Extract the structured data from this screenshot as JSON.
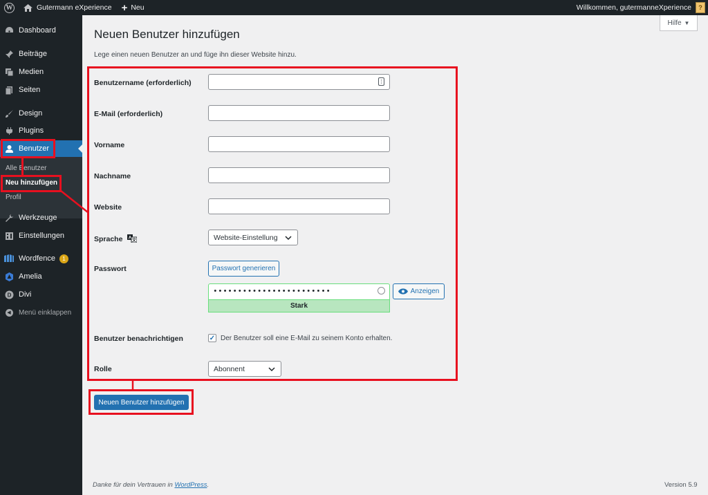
{
  "admin_bar": {
    "site_name": "Gutermann eXperience",
    "new_label": "Neu",
    "welcome": "Willkommen, gutermanneXperience"
  },
  "sidebar": {
    "items": [
      {
        "label": "Dashboard",
        "icon": "dashboard-icon"
      },
      {
        "label": "Beiträge",
        "icon": "pin-icon"
      },
      {
        "label": "Medien",
        "icon": "media-icon"
      },
      {
        "label": "Seiten",
        "icon": "pages-icon"
      },
      {
        "label": "Design",
        "icon": "brush-icon"
      },
      {
        "label": "Plugins",
        "icon": "plugin-icon"
      },
      {
        "label": "Benutzer",
        "icon": "user-icon"
      },
      {
        "label": "Werkzeuge",
        "icon": "wrench-icon"
      },
      {
        "label": "Einstellungen",
        "icon": "settings-icon"
      },
      {
        "label": "Wordfence",
        "icon": "wordfence-icon",
        "badge": "1"
      },
      {
        "label": "Amelia",
        "icon": "amelia-icon"
      },
      {
        "label": "Divi",
        "icon": "divi-icon"
      }
    ],
    "submenu": [
      "Alle Benutzer",
      "Neu hinzufügen",
      "Profil"
    ],
    "collapse_label": "Menü einklappen"
  },
  "page": {
    "title": "Neuen Benutzer hinzufügen",
    "help_label": "Hilfe",
    "description": "Lege einen neuen Benutzer an und füge ihn dieser Website hinzu."
  },
  "form": {
    "username_label": "Benutzername (erforderlich)",
    "username_value": "",
    "email_label": "E-Mail (erforderlich)",
    "email_value": "",
    "firstname_label": "Vorname",
    "firstname_value": "",
    "lastname_label": "Nachname",
    "lastname_value": "",
    "website_label": "Website",
    "website_value": "",
    "language_label": "Sprache",
    "language_value": "Website-Einstellung",
    "password_label": "Passwort",
    "generate_password_label": "Passwort generieren",
    "password_masked": "••••••••••••••••••••••••",
    "show_label": "Anzeigen",
    "strength_label": "Stark",
    "notify_label": "Benutzer benachrichtigen",
    "notify_checked": true,
    "notify_text": "Der Benutzer soll eine E-Mail zu seinem Konto erhalten.",
    "role_label": "Rolle",
    "role_value": "Abonnent",
    "submit_label": "Neuen Benutzer hinzufügen"
  },
  "footer": {
    "thanks_prefix": "Danke für dein Vertrauen in ",
    "thanks_link": "WordPress",
    "thanks_suffix": ".",
    "version": "Version 5.9"
  },
  "colors": {
    "admin_bar": "#1d2327",
    "accent": "#2271b1",
    "annotation": "#e8101f",
    "strength_ok": "#b8e6bf"
  }
}
